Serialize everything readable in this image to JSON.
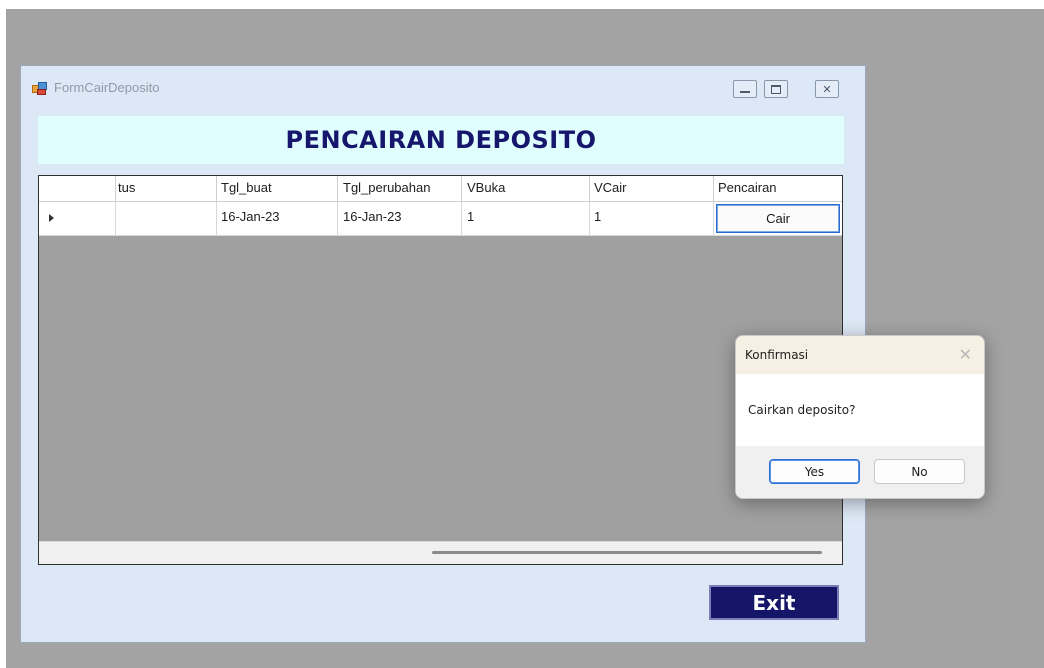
{
  "window": {
    "title": "FormCairDeposito",
    "controls": {
      "minimize_icon": "minimize-icon",
      "maximize_icon": "maximize-icon",
      "close_icon": "close-icon"
    }
  },
  "header": {
    "title": "PENCAIRAN DEPOSITO",
    "background": "#e1fefe",
    "color": "#15166c"
  },
  "grid": {
    "columns": [
      "",
      "tus",
      "Tgl_buat",
      "Tgl_perubahan",
      "VBuka",
      "VCair",
      "Pencairan"
    ],
    "rows": [
      {
        "status": "",
        "tgl_buat": "16-Jan-23",
        "tgl_perubahan": "16-Jan-23",
        "vbuka": "1",
        "vcair": "1",
        "pencairan_button": "Cair"
      }
    ]
  },
  "exit_button": {
    "label": "Exit",
    "color": "#161668"
  },
  "dialog": {
    "title": "Konfirmasi",
    "message": "Cairkan deposito?",
    "yes_label": "Yes",
    "no_label": "No",
    "close_glyph": "✕"
  }
}
